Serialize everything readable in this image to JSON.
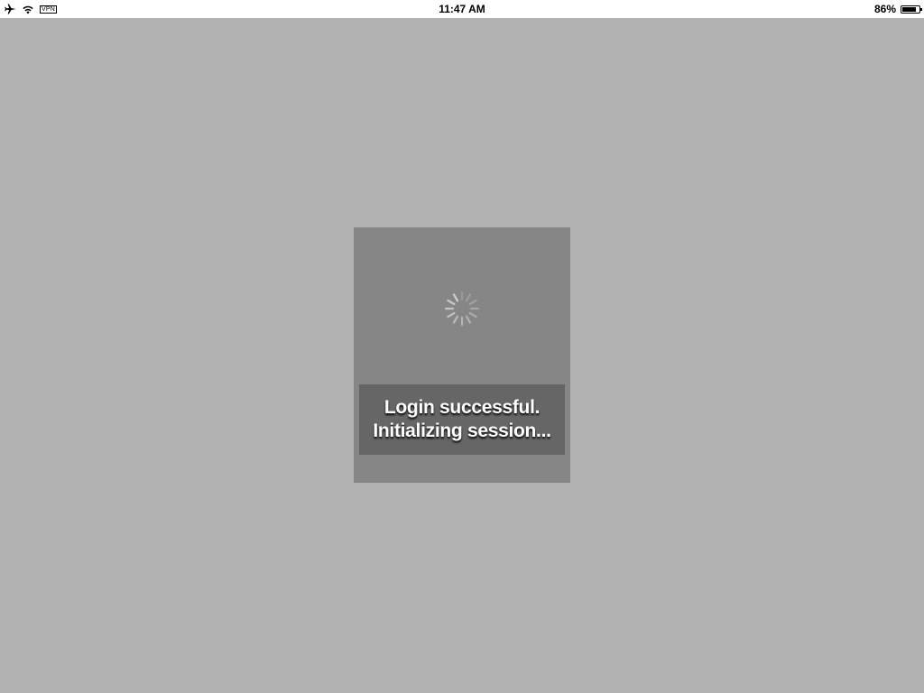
{
  "status_bar": {
    "time": "11:47 AM",
    "vpn_label": "VPN",
    "battery_percent_label": "86%",
    "battery_level": 0.86,
    "icons": [
      "airplane-icon",
      "wifi-icon",
      "vpn-icon",
      "battery-icon"
    ]
  },
  "overlay": {
    "spinner_icon": "activity-spinner-icon",
    "message_line1": "Login successful.",
    "message_line2": "Initializing session..."
  },
  "colors": {
    "background": "#b2b2b2",
    "panel": "#868686",
    "message_box": "#666666",
    "text": "#ffffff"
  }
}
